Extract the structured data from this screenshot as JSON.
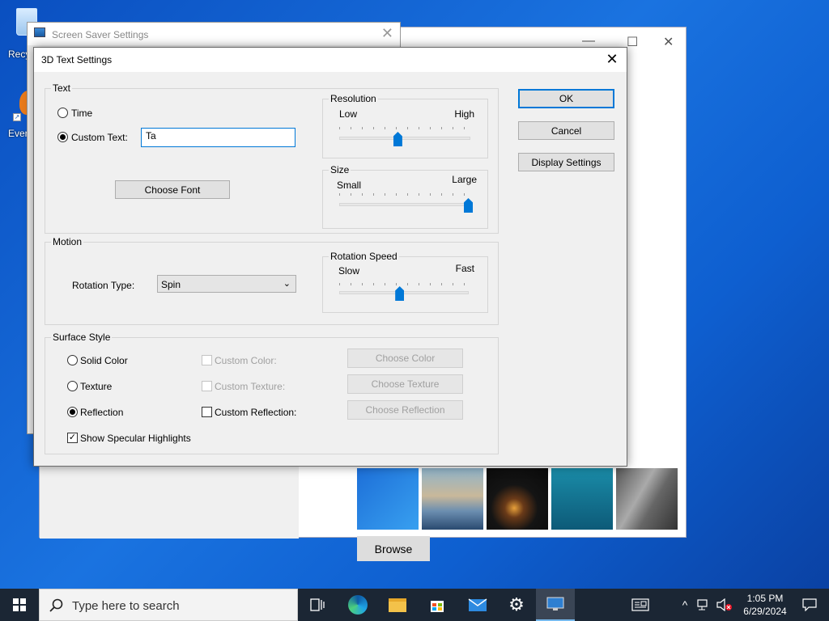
{
  "desktop": {
    "icons": [
      {
        "label": "Recy"
      },
      {
        "label": "Ever"
      }
    ]
  },
  "bg_window": {
    "browse_label": "Browse",
    "thumbnails": [
      "windows-blue-wallpaper",
      "beach-reflection-wallpaper",
      "night-tent-wallpaper",
      "underwater-wallpaper",
      "rocks-wallpaper"
    ]
  },
  "screen_saver_window": {
    "title": "Screen Saver Settings"
  },
  "dialog": {
    "title": "3D Text Settings",
    "close_glyph": "✕",
    "buttons": {
      "ok": "OK",
      "cancel": "Cancel",
      "display_settings": "Display Settings"
    },
    "text_group": {
      "label": "Text",
      "time_label": "Time",
      "custom_text_label": "Custom Text:",
      "custom_text_value": "Ta",
      "time_selected": false,
      "custom_selected": true,
      "choose_font": "Choose Font"
    },
    "resolution": {
      "label": "Resolution",
      "low": "Low",
      "high": "High",
      "level": 0.45
    },
    "size": {
      "label": "Size",
      "small": "Small",
      "large": "Large",
      "level": 1.0
    },
    "motion": {
      "label": "Motion",
      "rotation_type_label": "Rotation Type:",
      "rotation_type_value": "Spin"
    },
    "rotation_speed": {
      "label": "Rotation Speed",
      "slow": "Slow",
      "fast": "Fast",
      "level": 0.47
    },
    "surface": {
      "label": "Surface Style",
      "solid_color": "Solid Color",
      "texture": "Texture",
      "reflection": "Reflection",
      "selected": "Reflection",
      "custom_color": "Custom Color:",
      "custom_texture": "Custom Texture:",
      "custom_reflection": "Custom Reflection:",
      "choose_color": "Choose Color",
      "choose_texture": "Choose Texture",
      "choose_reflection": "Choose Reflection",
      "specular": "Show Specular Highlights",
      "specular_checked": true,
      "custom_reflection_checked": false
    }
  },
  "taskbar": {
    "search_placeholder": "Type here to search",
    "time": "1:05 PM",
    "date": "6/29/2024",
    "apps": [
      "task-view",
      "edge",
      "file-explorer",
      "store",
      "mail",
      "settings",
      "screen-saver"
    ]
  },
  "colors": {
    "accent": "#0078d7",
    "taskbar": "#1b2634"
  }
}
